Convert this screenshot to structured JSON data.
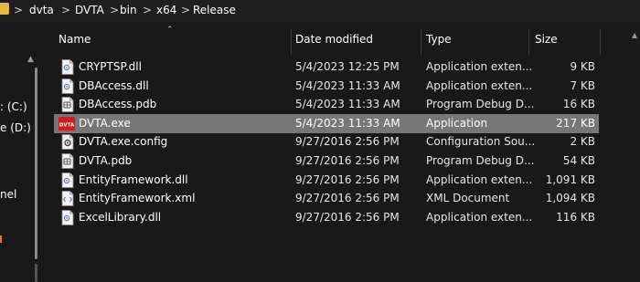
{
  "breadcrumb": [
    "dvta",
    "DVTA",
    "bin",
    "x64",
    "Release"
  ],
  "breadcrumb_separator": ">",
  "nav": [
    {
      "label": ": (C:)"
    },
    {
      "label": "e (D:)"
    },
    {
      "label": "nel"
    }
  ],
  "columns": {
    "name": "Name",
    "date": "Date modified",
    "type": "Type",
    "size": "Size"
  },
  "files": [
    {
      "name": "CRYPTSP.dll",
      "date": "5/4/2023 12:25 PM",
      "type": "Application exten...",
      "size": "9 KB",
      "icon": "dll-file-icon"
    },
    {
      "name": "DBAccess.dll",
      "date": "5/4/2023 11:33 AM",
      "type": "Application exten...",
      "size": "7 KB",
      "icon": "dll-file-icon"
    },
    {
      "name": "DBAccess.pdb",
      "date": "5/4/2023 11:33 AM",
      "type": "Program Debug D...",
      "size": "16 KB",
      "icon": "pdb-file-icon"
    },
    {
      "name": "DVTA.exe",
      "date": "5/4/2023 11:33 AM",
      "type": "Application",
      "size": "217 KB",
      "icon": "dvta-app-icon",
      "selected": true,
      "icon_text": "DVTA"
    },
    {
      "name": "DVTA.exe.config",
      "date": "9/27/2016 2:56 PM",
      "type": "Configuration Sou...",
      "size": "2 KB",
      "icon": "config-file-icon"
    },
    {
      "name": "DVTA.pdb",
      "date": "9/27/2016 2:56 PM",
      "type": "Program Debug D...",
      "size": "54 KB",
      "icon": "pdb-file-icon"
    },
    {
      "name": "EntityFramework.dll",
      "date": "9/27/2016 2:56 PM",
      "type": "Application exten...",
      "size": "1,091 KB",
      "icon": "dll-file-icon"
    },
    {
      "name": "EntityFramework.xml",
      "date": "9/27/2016 2:56 PM",
      "type": "XML Document",
      "size": "1,094 KB",
      "icon": "xml-file-icon"
    },
    {
      "name": "ExcelLibrary.dll",
      "date": "9/27/2016 2:56 PM",
      "type": "Application exten...",
      "size": "116 KB",
      "icon": "dll-file-icon"
    }
  ],
  "colors": {
    "background": "#191919",
    "selected_row": "#777777",
    "dvta_icon": "#c8201e",
    "folder": "#e8b73f"
  }
}
